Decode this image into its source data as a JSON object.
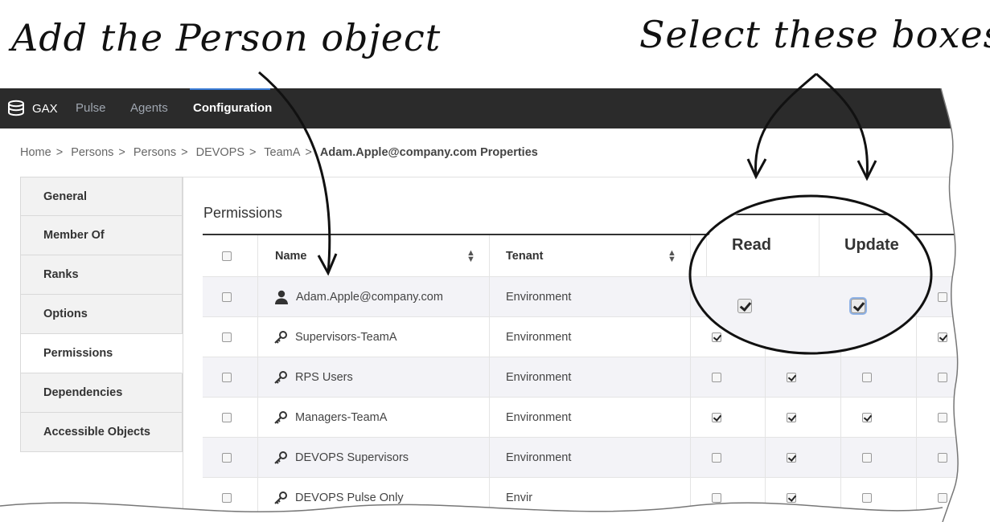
{
  "callouts": {
    "left": "Add the Person object",
    "right": "Select these boxes"
  },
  "topbar": {
    "brand": "GAX",
    "nav": [
      "Pulse",
      "Agents",
      "Configuration"
    ],
    "active": "Configuration"
  },
  "breadcrumb": [
    "Home",
    "Persons",
    "Persons",
    "DEVOPS",
    "TeamA"
  ],
  "breadcrumb_current": "Adam.Apple@company.com Properties",
  "sidebar": {
    "items": [
      "General",
      "Member Of",
      "Ranks",
      "Options",
      "Permissions",
      "Dependencies",
      "Accessible Objects"
    ],
    "active": "Permissions"
  },
  "section_title": "Permissions",
  "table": {
    "columns": [
      "Name",
      "Tenant"
    ],
    "zoom_columns": [
      "Read",
      "Update"
    ],
    "rows": [
      {
        "name": "Adam.Apple@company.com",
        "tenant": "Environment",
        "type": "person",
        "checks": [
          true,
          false,
          true,
          false
        ]
      },
      {
        "name": "Supervisors-TeamA",
        "tenant": "Environment",
        "type": "group",
        "checks": [
          true,
          false,
          false,
          true
        ]
      },
      {
        "name": "RPS Users",
        "tenant": "Environment",
        "type": "group",
        "checks": [
          false,
          true,
          false,
          false
        ]
      },
      {
        "name": "Managers-TeamA",
        "tenant": "Environment",
        "type": "group",
        "checks": [
          true,
          true,
          true,
          false
        ]
      },
      {
        "name": "DEVOPS Supervisors",
        "tenant": "Environment",
        "type": "group",
        "checks": [
          false,
          true,
          false,
          false
        ]
      },
      {
        "name": "DEVOPS Pulse Only",
        "tenant": "Envir",
        "type": "group",
        "checks": [
          false,
          true,
          false,
          false
        ]
      }
    ]
  }
}
